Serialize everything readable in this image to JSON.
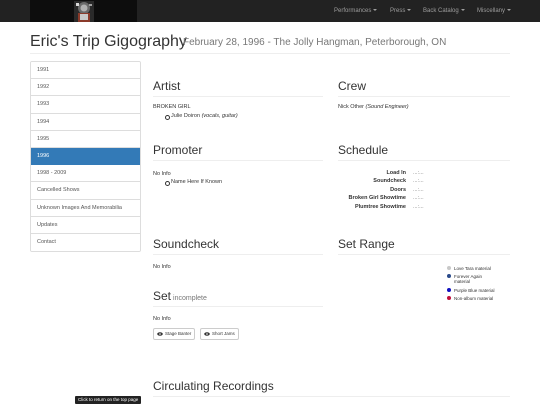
{
  "navbar": {
    "items": [
      {
        "label": "Performances"
      },
      {
        "label": "Press"
      },
      {
        "label": "Back Catalog"
      },
      {
        "label": "Miscellany"
      }
    ]
  },
  "header": {
    "title": "Eric's Trip Gigography",
    "subtitle": "February 28, 1996 - The Jolly Hangman, Peterborough, ON"
  },
  "sidebar": {
    "items": [
      {
        "label": "1991"
      },
      {
        "label": "1992"
      },
      {
        "label": "1993"
      },
      {
        "label": "1994"
      },
      {
        "label": "1995"
      },
      {
        "label": "1996"
      },
      {
        "label": "1998 - 2009"
      },
      {
        "label": "Cancelled Shows"
      },
      {
        "label": "Unknown Images And Memorabilia"
      },
      {
        "label": "Updates"
      },
      {
        "label": "Contact"
      }
    ],
    "active": "1996"
  },
  "artist": {
    "heading": "Artist",
    "name": "BROKEN GIRL",
    "member_name": "Julie Doiron",
    "member_role": "(vocals, guitar)"
  },
  "crew": {
    "heading": "Crew",
    "name": "Nick Other",
    "role": "(Sound Engineer)"
  },
  "promoter": {
    "heading": "Promoter",
    "info": "No Info",
    "bullet": "Name Here If Known"
  },
  "schedule": {
    "heading": "Schedule",
    "rows": [
      {
        "label": "Load In",
        "value": "...:..."
      },
      {
        "label": "Soundcheck",
        "value": "...:..."
      },
      {
        "label": "Doors",
        "value": "...:..."
      },
      {
        "label": "Broken Girl Showtime",
        "value": "...:..."
      },
      {
        "label": "Plumtree Showtime",
        "value": "...:..."
      }
    ]
  },
  "soundcheck": {
    "heading": "Soundcheck",
    "info": "No Info"
  },
  "setrange": {
    "heading": "Set Range",
    "legend": [
      {
        "label": "Love Tara material",
        "color": "#c8c8c8"
      },
      {
        "label": "Forever Again material",
        "color": "#2a4a8a"
      },
      {
        "label": "Purple Blue material",
        "color": "#1010c0"
      },
      {
        "label": "Non-album material",
        "color": "#c0103a"
      }
    ]
  },
  "set": {
    "heading": "Set",
    "status": "incomplete",
    "info": "No Info",
    "buttons": [
      {
        "label": "Stage Banter"
      },
      {
        "label": "Short Jams"
      }
    ]
  },
  "recordings": {
    "heading": "Circulating Recordings"
  },
  "tooltip": {
    "label": "Click to return on the top page"
  }
}
